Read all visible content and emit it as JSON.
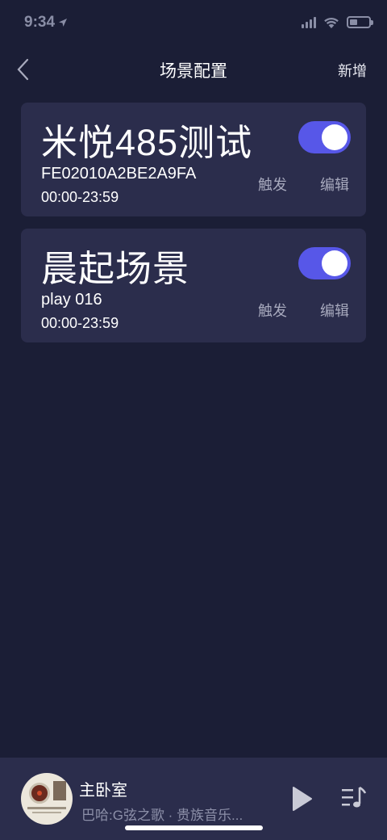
{
  "status_bar": {
    "time": "9:34",
    "location_icon": "location-arrow-icon",
    "signal_icon": "cell-signal-icon",
    "wifi_icon": "wifi-icon",
    "battery_icon": "battery-icon",
    "battery_level": 0.4
  },
  "nav": {
    "back_icon": "chevron-left-icon",
    "title": "场景配置",
    "add_label": "新增"
  },
  "scenes": [
    {
      "name": "米悦485测试",
      "subtitle": "FE02010A2BE2A9FA",
      "time_range": "00:00-23:59",
      "enabled": true,
      "trigger_label": "触发",
      "edit_label": "编辑"
    },
    {
      "name": "晨起场景",
      "subtitle": "play 016",
      "time_range": "00:00-23:59",
      "enabled": true,
      "trigger_label": "触发",
      "edit_label": "编辑"
    }
  ],
  "player": {
    "room": "主卧室",
    "track": "巴哈:G弦之歌 · 贵族音乐...",
    "play_icon": "play-icon",
    "playlist_icon": "playlist-music-icon"
  },
  "colors": {
    "background": "#1b1e36",
    "card": "#2b2d4c",
    "accent": "#5757e8",
    "muted_text": "#a7a9bd"
  }
}
